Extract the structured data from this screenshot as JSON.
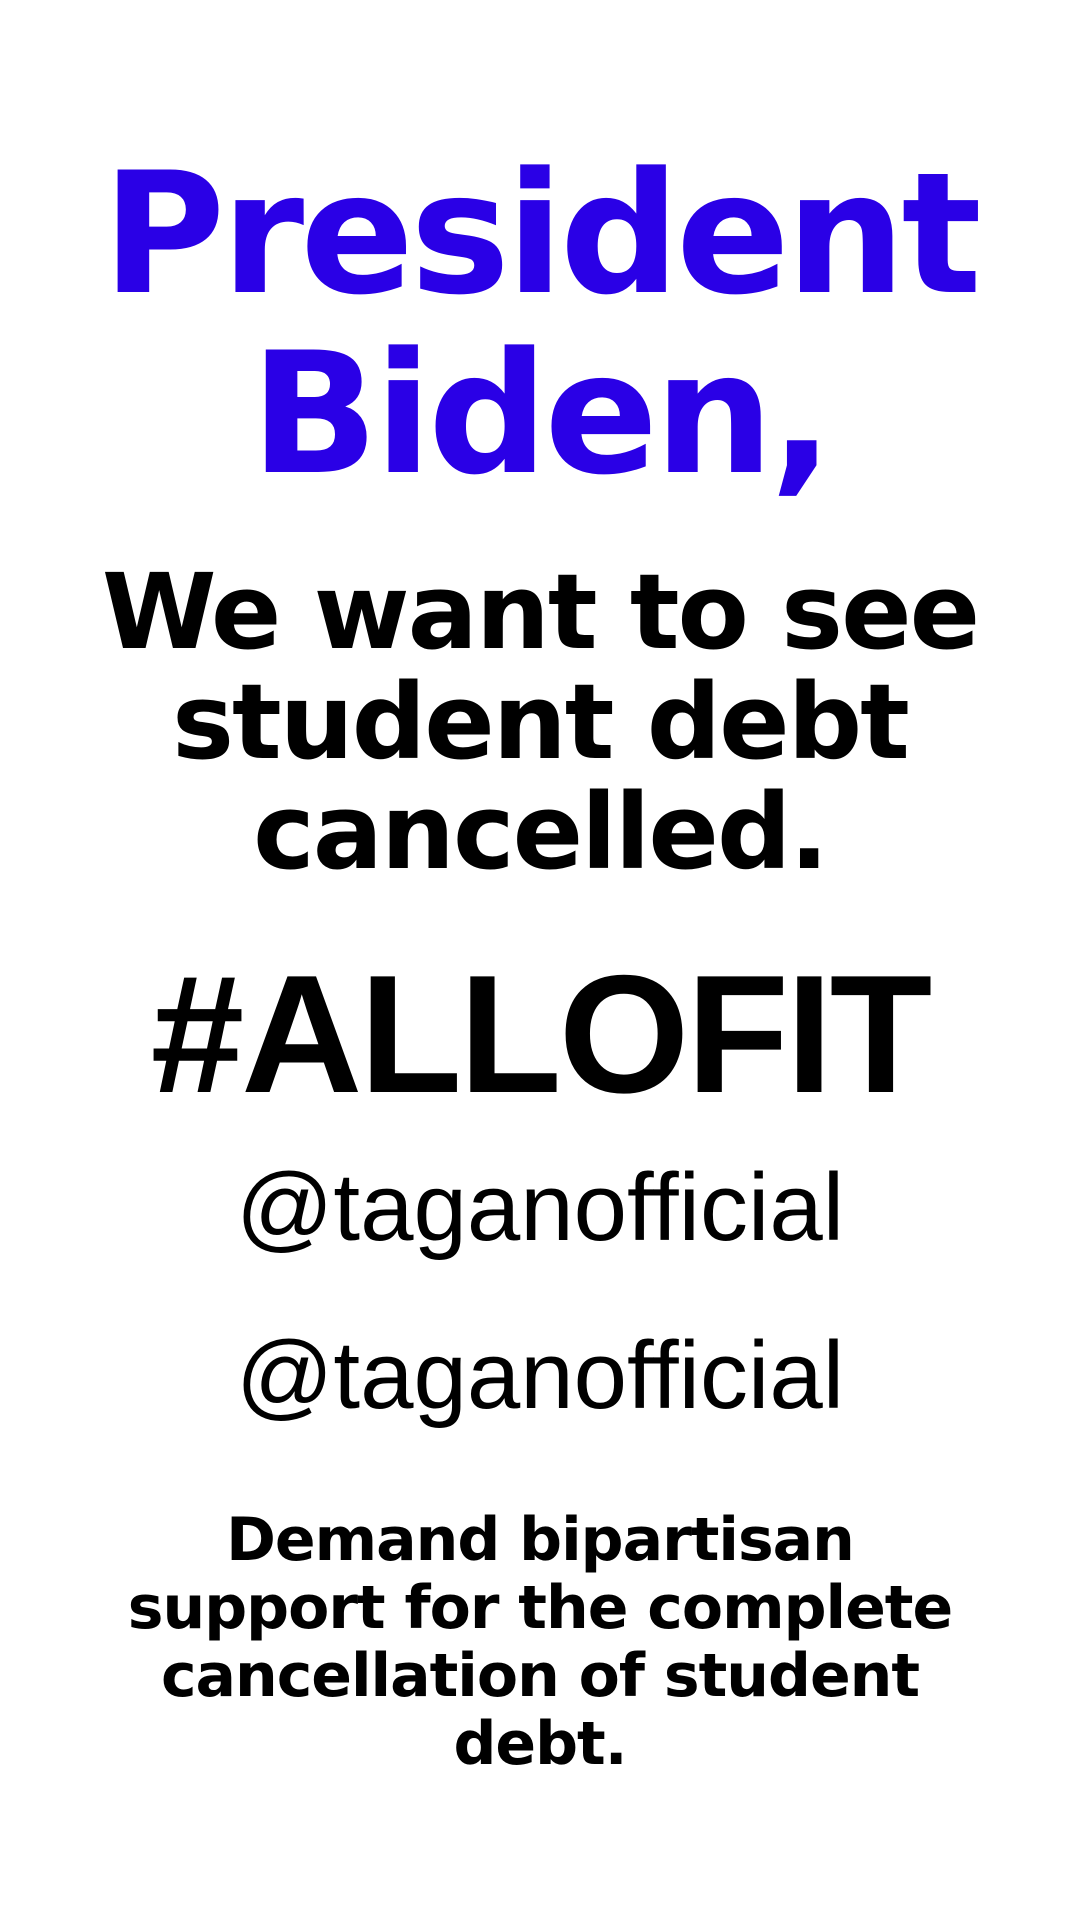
{
  "colors": {
    "accent": "#2a00e6",
    "text": "#000000",
    "background": "#ffffff"
  },
  "headline": {
    "line1": "President",
    "line2": "Biden,"
  },
  "message": {
    "line1": "We want to see",
    "line2": "student debt",
    "line3": "cancelled."
  },
  "hashtag": "#ALLOFIT",
  "handles": [
    "@taganofficial",
    "@taganofficial"
  ],
  "call_to_action": {
    "line1": "Demand bipartisan",
    "line2": "support for the complete",
    "line3": "cancellation of student",
    "line4": "debt."
  }
}
